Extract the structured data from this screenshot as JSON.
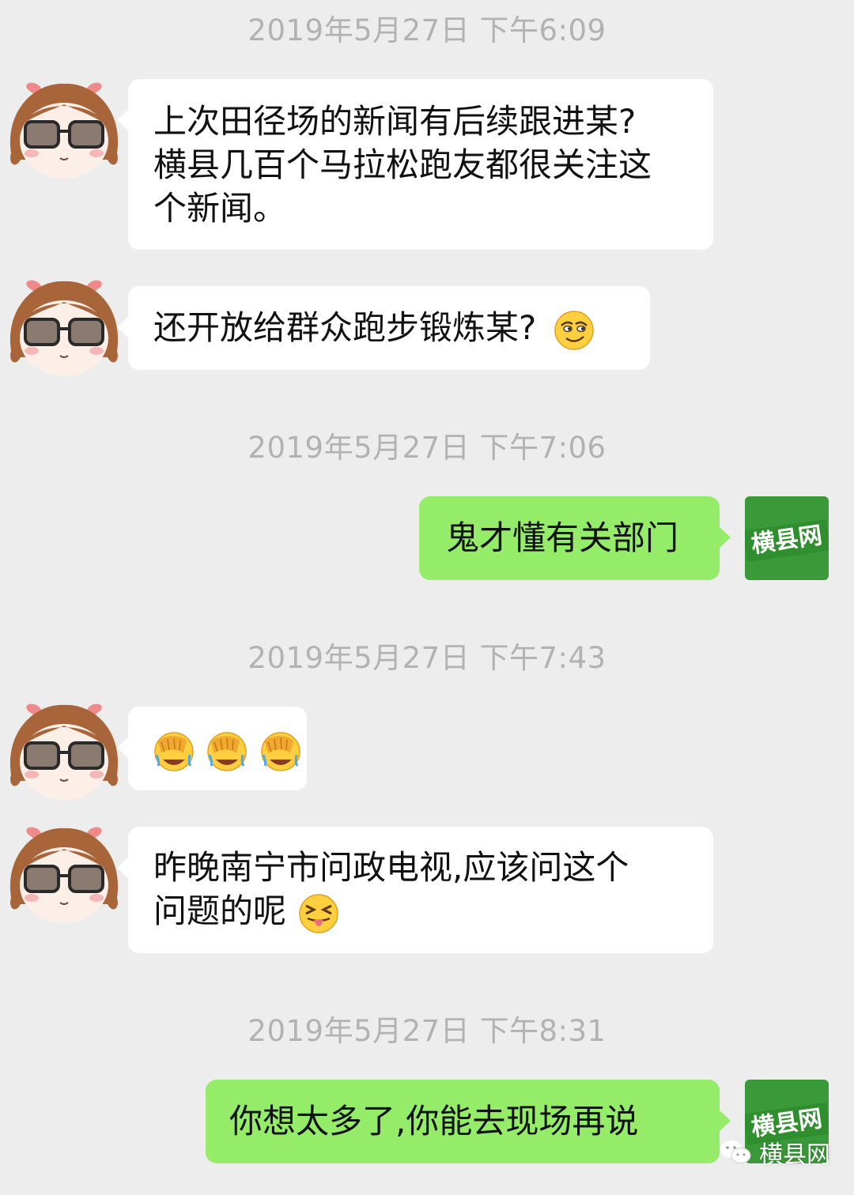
{
  "timestamps": [
    "2019年5月27日 下午6:09",
    "2019年5月27日 下午7:06",
    "2019年5月27日 下午7:43",
    "2019年5月27日 下午8:31"
  ],
  "messages": {
    "m1": [
      "上次田径场的新闻有后续跟进某?",
      "横县几百个马拉松跑友都很关注这",
      "个新闻。"
    ],
    "m2": "还开放给群众跑步锻炼某?",
    "m3": "鬼才懂有关部门",
    "m5": [
      "昨晚南宁市问政电视,应该问这个",
      "问题的呢"
    ],
    "m6": "你想太多了,你能去现场再说"
  },
  "logo_text": "横县网",
  "watermark": "横县网",
  "icons": [
    "cartoon-girl-sunglasses-avatar",
    "smirk-emoji",
    "facepalm-emoji",
    "tongue-out-emoji",
    "wechat-logo-icon"
  ],
  "colors": {
    "background": "#ededed",
    "incoming_bubble": "#ffffff",
    "outgoing_bubble": "#95ec69",
    "timestamp": "#b2b2b2",
    "logo_green": "#3a9a3a"
  }
}
